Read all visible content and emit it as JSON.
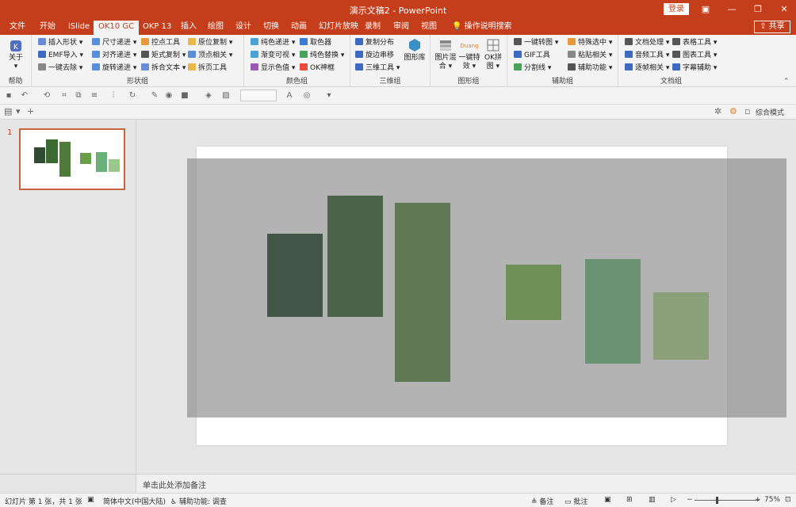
{
  "titlebar": {
    "title": "演示文稿2 - PowerPoint",
    "login": "登录",
    "buttons": [
      "restore-ribbon",
      "minimize",
      "maximize",
      "close"
    ]
  },
  "tabs": [
    "文件",
    "开始",
    "iSlide",
    "OK10 GC",
    "OKP 13",
    "插入",
    "绘图",
    "设计",
    "切换",
    "动画",
    "幻灯片放映",
    "录制",
    "审阅",
    "视图",
    "操作说明搜索"
  ],
  "active_tab": "OK10 GC",
  "share": "共享",
  "ribbon": {
    "help": {
      "about": "关于",
      "label": "帮助"
    },
    "shape_group": {
      "label": "形状组",
      "items": [
        "插入形状",
        "EMF导入",
        "一键去除",
        "尺寸递进",
        "对齐递进",
        "旋转递进",
        "控点工具",
        "矩式复制",
        "拆合文本",
        "原位复制",
        "顶点相关",
        "拆页工具"
      ]
    },
    "color_group": {
      "label": "颜色组",
      "items": [
        "纯色递进",
        "渐变可视",
        "显示色值",
        "取色器",
        "纯色替换",
        "OK神框"
      ]
    },
    "3d_group": {
      "label": "三维组",
      "items": [
        "复制分布",
        "旋边串移",
        "三维工具"
      ],
      "big": "图形库"
    },
    "image_group": {
      "label": "图形组",
      "items": [
        "图片混合",
        "一键特效",
        "OK拼图"
      ]
    },
    "assist_group": {
      "label": "辅助组",
      "items": [
        "一键转图",
        "GIF工具",
        "分割线",
        "特殊选中",
        "粘贴相关",
        "辅助功能"
      ]
    },
    "doc_group": {
      "label": "文档组",
      "items": [
        "文档处理",
        "音频工具",
        "逐帧相关",
        "表格工具",
        "图表工具",
        "字幕辅助"
      ]
    }
  },
  "row2": {
    "mode": "综合模式"
  },
  "thumbnail": {
    "number": "1"
  },
  "notes": {
    "placeholder": "单击此处添加备注"
  },
  "status": {
    "slide_info": "幻灯片 第 1 张，共 1 张",
    "language": "简体中文(中国大陆)",
    "accessibility": "辅助功能: 调查",
    "notes_btn": "备注",
    "comments_btn": "批注",
    "zoom": "75%"
  },
  "colors": {
    "titlebar": "#c43e1c",
    "rect1": "#435648",
    "rect2": "#4b6449",
    "rect3": "#617854",
    "rect4": "#6e9157",
    "rect5": "#6a9374",
    "rect6": "#8ba079"
  }
}
